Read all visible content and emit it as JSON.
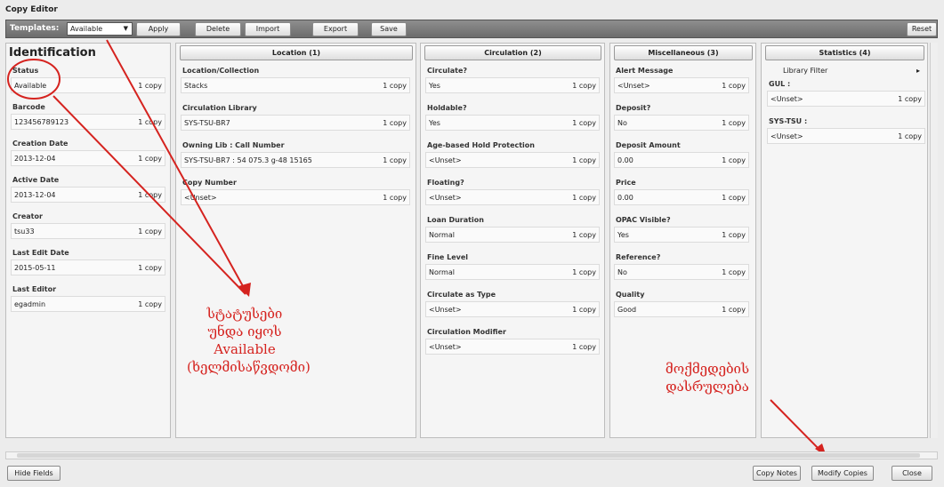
{
  "window": {
    "title": "Copy Editor"
  },
  "toolbar": {
    "templates_label": "Templates:",
    "template_value": "Available",
    "apply": "Apply",
    "delete": "Delete",
    "import": "Import",
    "export": "Export",
    "save": "Save",
    "reset": "Reset"
  },
  "identification": {
    "title": "Identification",
    "fields": [
      {
        "label": "Status",
        "value": "Available",
        "count": "1 copy"
      },
      {
        "label": "Barcode",
        "value": "123456789123",
        "count": "1 copy"
      },
      {
        "label": "Creation Date",
        "value": "2013-12-04",
        "count": "1 copy"
      },
      {
        "label": "Active Date",
        "value": "2013-12-04",
        "count": "1 copy"
      },
      {
        "label": "Creator",
        "value": "tsu33",
        "count": "1 copy"
      },
      {
        "label": "Last Edit Date",
        "value": "2015-05-11",
        "count": "1 copy"
      },
      {
        "label": "Last Editor",
        "value": "egadmin",
        "count": "1 copy"
      }
    ]
  },
  "location": {
    "header": "Location (1)",
    "fields": [
      {
        "label": "Location/Collection",
        "value": "Stacks",
        "count": "1 copy"
      },
      {
        "label": "Circulation Library",
        "value": "SYS-TSU-BR7",
        "count": "1 copy"
      },
      {
        "label": "Owning Lib : Call Number",
        "value": "SYS-TSU-BR7 : 54 075.3 g-48 15165",
        "count": "1 copy"
      },
      {
        "label": "Copy Number",
        "value": "<Unset>",
        "count": "1 copy"
      }
    ]
  },
  "circulation": {
    "header": "Circulation (2)",
    "fields": [
      {
        "label": "Circulate?",
        "value": "Yes",
        "count": "1 copy"
      },
      {
        "label": "Holdable?",
        "value": "Yes",
        "count": "1 copy"
      },
      {
        "label": "Age-based Hold Protection",
        "value": "<Unset>",
        "count": "1 copy"
      },
      {
        "label": "Floating?",
        "value": "<Unset>",
        "count": "1 copy"
      },
      {
        "label": "Loan Duration",
        "value": "Normal",
        "count": "1 copy"
      },
      {
        "label": "Fine Level",
        "value": "Normal",
        "count": "1 copy"
      },
      {
        "label": "Circulate as Type",
        "value": "<Unset>",
        "count": "1 copy"
      },
      {
        "label": "Circulation Modifier",
        "value": "<Unset>",
        "count": "1 copy"
      }
    ]
  },
  "misc": {
    "header": "Miscellaneous (3)",
    "fields": [
      {
        "label": "Alert Message",
        "value": "<Unset>",
        "count": "1 copy"
      },
      {
        "label": "Deposit?",
        "value": "No",
        "count": "1 copy"
      },
      {
        "label": "Deposit Amount",
        "value": "0.00",
        "count": "1 copy"
      },
      {
        "label": "Price",
        "value": "0.00",
        "count": "1 copy"
      },
      {
        "label": "OPAC Visible?",
        "value": "Yes",
        "count": "1 copy"
      },
      {
        "label": "Reference?",
        "value": "No",
        "count": "1 copy"
      },
      {
        "label": "Quality",
        "value": "Good",
        "count": "1 copy"
      }
    ]
  },
  "statistics": {
    "header": "Statistics (4)",
    "filter": "Library Filter",
    "groups": [
      {
        "label": "GUL :",
        "value": "<Unset>",
        "count": "1 copy"
      },
      {
        "label": "SYS-TSU :",
        "value": "<Unset>",
        "count": "1 copy"
      }
    ]
  },
  "annotations": {
    "left_lines": [
      "სტატუსები",
      "უნდა იყოს",
      "Available",
      "(ხელმისაწვდომი)"
    ],
    "right_lines": [
      "მოქმედების",
      "დასრულება"
    ],
    "color": "#d5231f"
  },
  "footer": {
    "hide_fields": "Hide Fields",
    "copy_notes": "Copy Notes",
    "modify_copies": "Modify Copies",
    "close": "Close"
  }
}
